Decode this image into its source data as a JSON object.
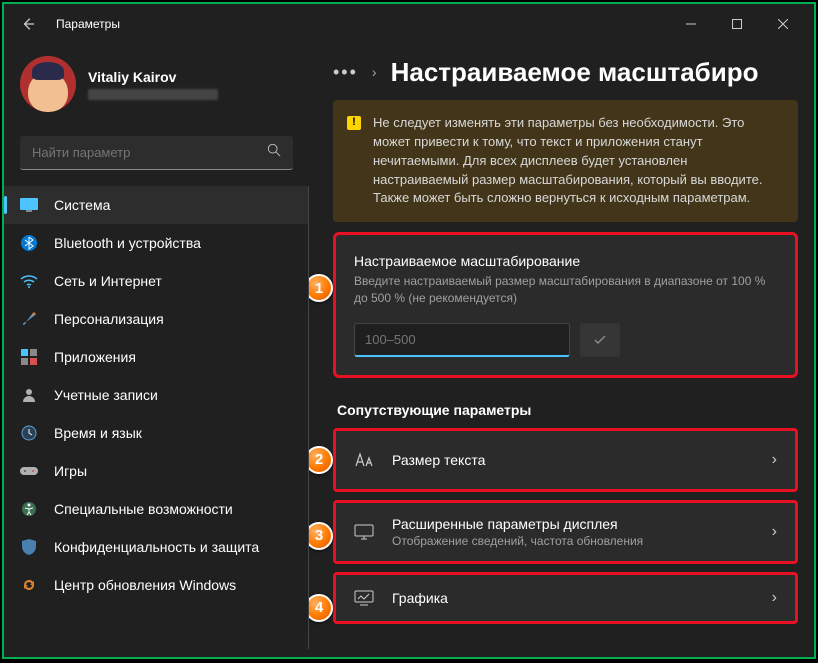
{
  "window": {
    "title": "Параметры"
  },
  "user": {
    "name": "Vitaliy Kairov"
  },
  "search": {
    "placeholder": "Найти параметр"
  },
  "nav": [
    {
      "label": "Система",
      "icon": "🖥️",
      "active": true
    },
    {
      "label": "Bluetooth и устройства",
      "icon": "bt"
    },
    {
      "label": "Сеть и Интернет",
      "icon": "wifi"
    },
    {
      "label": "Персонализация",
      "icon": "brush"
    },
    {
      "label": "Приложения",
      "icon": "apps"
    },
    {
      "label": "Учетные записи",
      "icon": "user"
    },
    {
      "label": "Время и язык",
      "icon": "clock"
    },
    {
      "label": "Игры",
      "icon": "game"
    },
    {
      "label": "Специальные возможности",
      "icon": "access"
    },
    {
      "label": "Конфиденциальность и защита",
      "icon": "shield"
    },
    {
      "label": "Центр обновления Windows",
      "icon": "update"
    }
  ],
  "breadcrumb": {
    "dots": "…",
    "title": "Настраиваемое масштабиро"
  },
  "warning": {
    "text": "Не следует изменять эти параметры без необходимости. Это может привести к тому, что текст и приложения станут нечитаемыми. Для всех дисплеев будет установлен настраиваемый размер масштабирования, который вы вводите. Также может быть сложно вернуться к исходным параметрам."
  },
  "scale": {
    "title": "Настраиваемое масштабирование",
    "sub": "Введите настраиваемый размер масштабирования в диапазоне от 100 % до 500 % (не рекомендуется)",
    "placeholder": "100–500"
  },
  "related": {
    "heading": "Сопутствующие параметры",
    "items": [
      {
        "title": "Размер текста",
        "sub": ""
      },
      {
        "title": "Расширенные параметры дисплея",
        "sub": "Отображение сведений, частота обновления"
      },
      {
        "title": "Графика",
        "sub": ""
      }
    ]
  },
  "badges": [
    "1",
    "2",
    "3",
    "4"
  ]
}
